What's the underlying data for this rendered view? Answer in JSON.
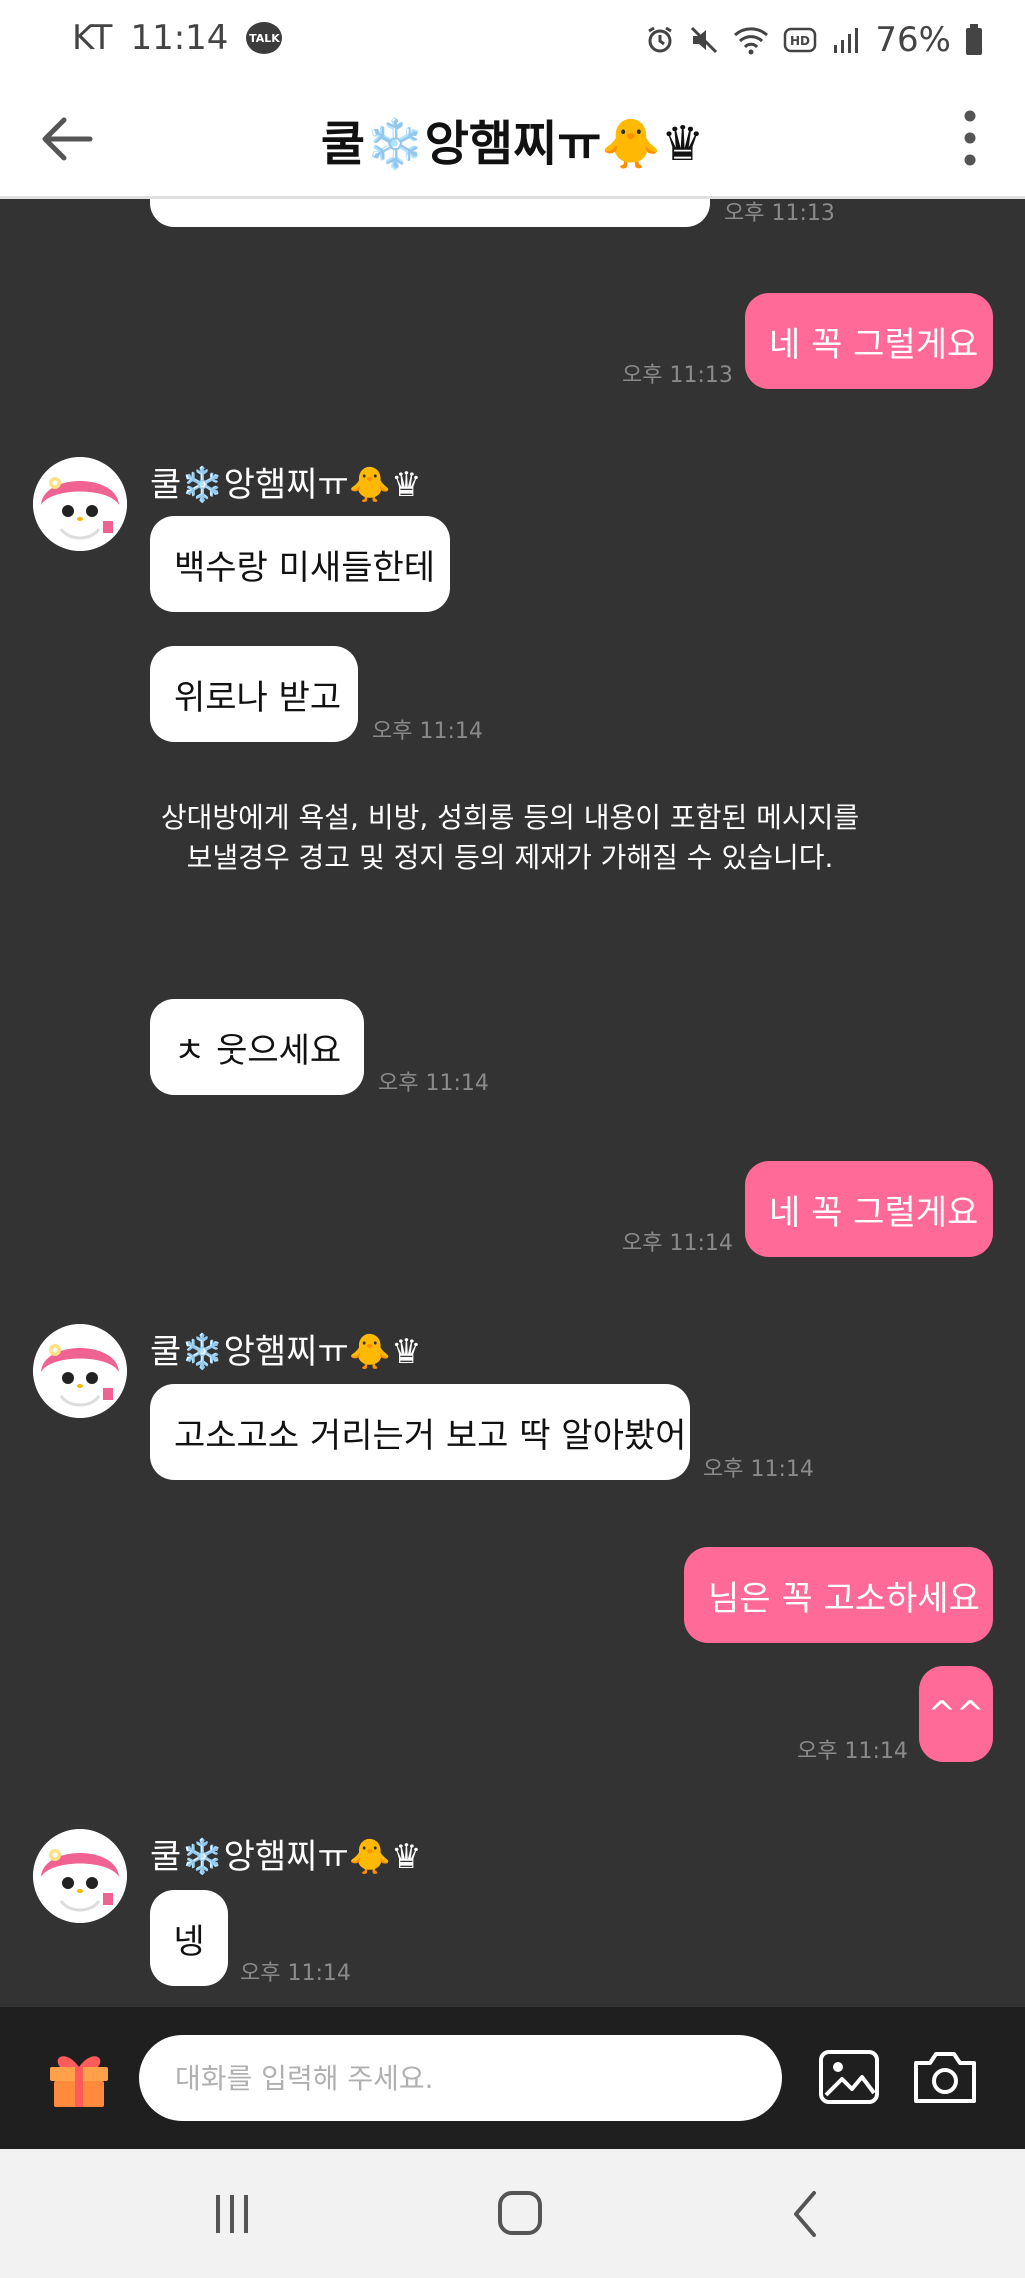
{
  "status_bar": {
    "carrier": "KT",
    "time": "11:14",
    "talk_badge": "TALK",
    "battery": "76%"
  },
  "header": {
    "title": "쿨❄️앙햄찌ㅠ🐥♛"
  },
  "chat": {
    "sender_name": "쿨❄️앙햄찌ㅠ🐥♛",
    "messages": [
      {
        "time": "오후 11:13"
      },
      {
        "text": "네 꼭 그럴게요",
        "time": "오후 11:13"
      },
      {
        "text": "백수랑 미새들한테"
      },
      {
        "text": "위로나 받고",
        "time": "오후 11:14"
      },
      {
        "text": "ㅊ 웃으세요",
        "time": "오후 11:14"
      },
      {
        "text": "네 꼭 그럴게요",
        "time": "오후 11:14"
      },
      {
        "text": "고소고소 거리는거 보고 딱 알아봤어",
        "time": "오후 11:14"
      },
      {
        "text": "님은 꼭 고소하세요"
      },
      {
        "text": "^^",
        "time": "오후 11:14"
      },
      {
        "text": "넹",
        "time": "오후 11:14"
      }
    ],
    "notice_line1": "상대방에게 욕설, 비방, 성희롱 등의 내용이 포함된 메시지를",
    "notice_line2": "보낼경우 경고 및 정지 등의 제재가 가해질 수 있습니다."
  },
  "composer": {
    "placeholder": "대화를 입력해 주세요."
  },
  "colors": {
    "bg": "#333333",
    "outgoing": "#ff6a98",
    "incoming": "#ffffff",
    "time": "#8a8a8a"
  },
  "icons": [
    "back-arrow-icon",
    "kebab-menu-icon",
    "gift-icon",
    "image-icon",
    "camera-icon",
    "recent-apps-icon",
    "home-icon",
    "nav-back-icon"
  ]
}
